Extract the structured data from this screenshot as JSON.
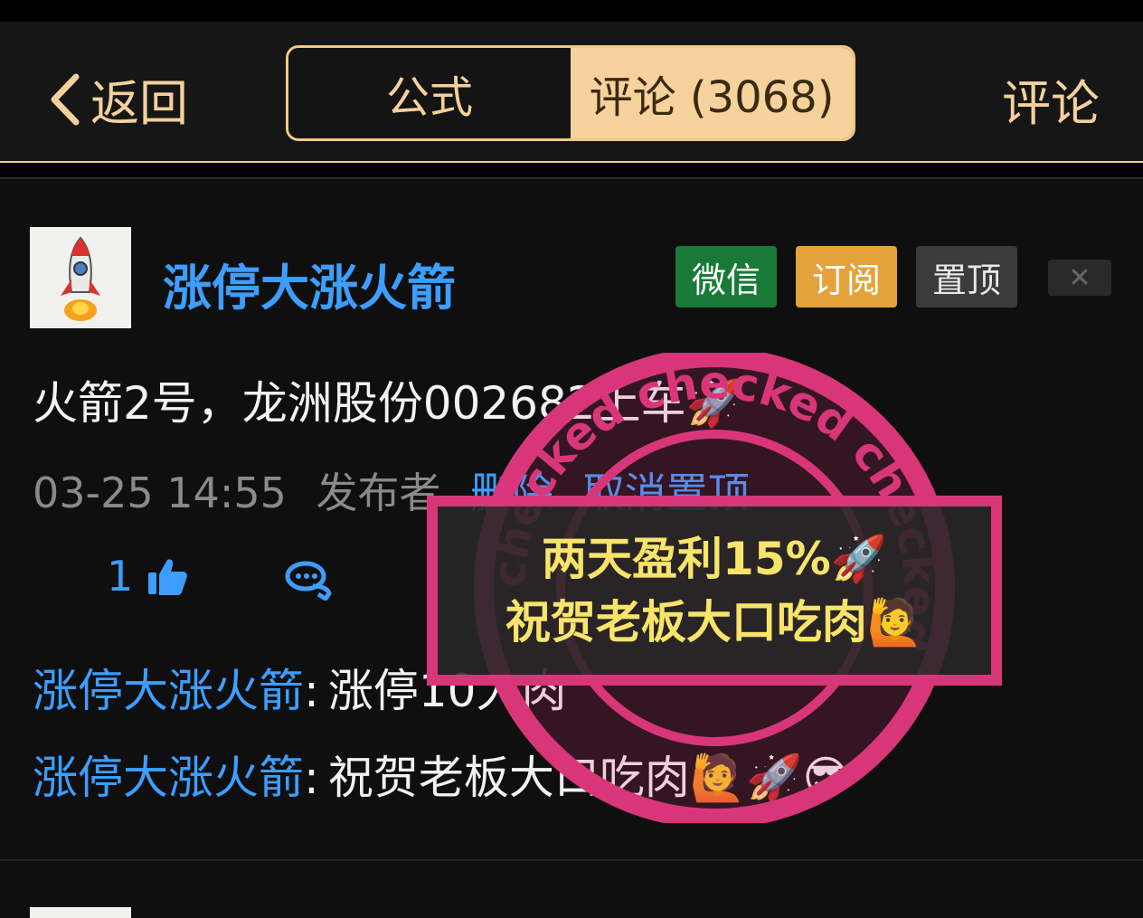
{
  "header": {
    "back_label": "返回",
    "tabs": [
      {
        "label": "公式",
        "active": false
      },
      {
        "label": "评论 (3068)",
        "active": true
      }
    ],
    "right_label": "评论"
  },
  "post": {
    "username": "涨停大涨火箭",
    "buttons": {
      "wechat": "微信",
      "subscribe": "订阅",
      "pin": "置顶",
      "close": "✕"
    },
    "text": "火箭2号，龙洲股份002682上车🚀",
    "timestamp": "03-25 14:55",
    "publisher": "发布者",
    "delete_link": "删除",
    "unpin_link": "取消置顶",
    "like_count": "1",
    "replies": [
      {
        "user": "涨停大涨火箭",
        "sep": ":",
        "text": "涨停10大肉"
      },
      {
        "user": "涨停大涨火箭",
        "sep": ":",
        "text": "祝贺老板大口吃肉🙋🚀😎"
      }
    ]
  },
  "stamp": {
    "ring_text": "checked checked checked",
    "line1": "两天盈利15%🚀",
    "line2": "祝贺老板大口吃肉🙋"
  },
  "colors": {
    "accent": "#f4d19c",
    "link": "#3d9eff",
    "wechat": "#187a36",
    "subscribe": "#e4a33a",
    "stamp": "#d9367a",
    "stamp_text": "#f8e46a"
  },
  "icons": [
    "chevron-left-icon",
    "rocket-icon",
    "thumbs-up-icon",
    "comment-icon",
    "close-icon"
  ]
}
